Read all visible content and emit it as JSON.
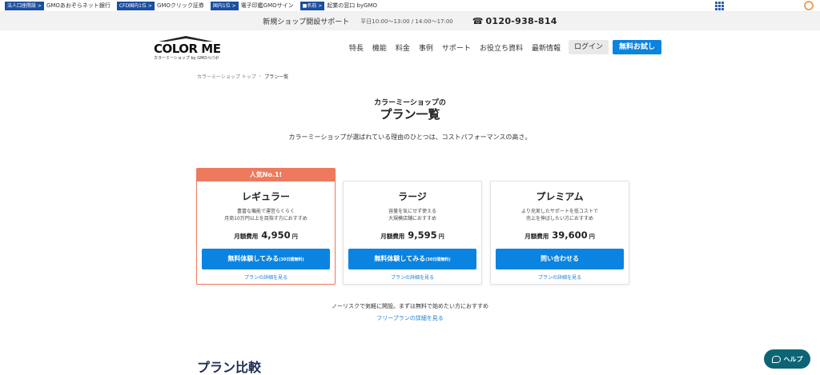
{
  "gmo_bar": {
    "items": [
      {
        "tag": "法人口座開設 >",
        "text": "GMOあおぞらネット銀行"
      },
      {
        "tag": "CFD国内1位 >",
        "text": "GMOクリック証券"
      },
      {
        "tag": "国内1位 >",
        "text": "電子印鑑GMOサイン"
      },
      {
        "tag": "■名前 >",
        "text": "起業の窓口 byGMO"
      }
    ]
  },
  "support": {
    "label": "新規ショップ開設サポート",
    "hours": "平日10:00～13:00 / 14:00～17:00",
    "phone": "0120-938-814",
    "phone_icon": "phone-icon"
  },
  "header": {
    "logo_text": "COLOR ME",
    "logo_sub": "カラーミーショップ by GMOペパボ",
    "nav": [
      "特長",
      "機能",
      "料金",
      "事例",
      "サポート",
      "お役立ち資料",
      "最新情報"
    ],
    "login_label": "ログイン",
    "trial_label": "無料お試し"
  },
  "breadcrumb": {
    "home": "カラーミーショップ トップ",
    "current": "プラン一覧"
  },
  "title": {
    "sub": "カラーミーショップの",
    "main": "プラン一覧",
    "lead": "カラーミーショップが選ばれている理由のひとつは、コストパフォーマンスの高さ。"
  },
  "plans": [
    {
      "ribbon": "人気No.1!",
      "name": "レギュラー",
      "desc1": "豊富な機能で運営らくらく",
      "desc2": "月商10万円以上を目指す方におすすめ",
      "price_label": "月額費用",
      "price": "4,950",
      "unit": "円",
      "button": "無料体験してみる",
      "button_note": "(30日間無料)",
      "link": "プランの詳細を見る"
    },
    {
      "name": "ラージ",
      "desc1": "容量を気にせず使える",
      "desc2": "大規模店舗におすすめ",
      "price_label": "月額費用",
      "price": "9,595",
      "unit": "円",
      "button": "無料体験してみる",
      "button_note": "(30日間無料)",
      "link": "プランの詳細を見る"
    },
    {
      "name": "プレミアム",
      "desc1": "より充実したサポートを低コストで",
      "desc2": "売上を伸ばしたい方におすすめ",
      "price_label": "月額費用",
      "price": "39,600",
      "unit": "円",
      "button": "問い合わせる",
      "link": "プランの詳細を見る"
    }
  ],
  "free": {
    "note": "ノーリスクで気軽に開設。まずは無料で始めたい方におすすめ",
    "link": "フリープランの詳細を見る"
  },
  "compare_title": "プラン比較",
  "help": {
    "label": "ヘルプ",
    "icon": "chat-bubble-icon"
  },
  "colors": {
    "primary": "#0a84e0",
    "featured": "#ee7a5e",
    "help": "#0c6475"
  }
}
